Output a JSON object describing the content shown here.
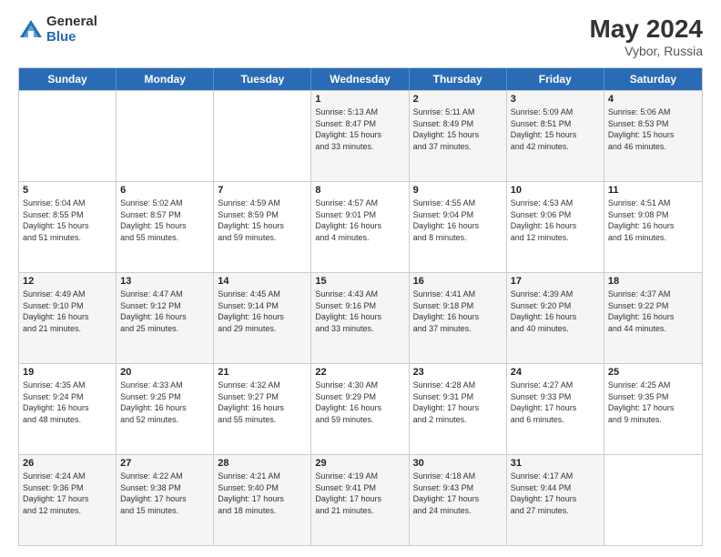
{
  "header": {
    "logo_general": "General",
    "logo_blue": "Blue",
    "month_year": "May 2024",
    "location": "Vybor, Russia"
  },
  "days_of_week": [
    "Sunday",
    "Monday",
    "Tuesday",
    "Wednesday",
    "Thursday",
    "Friday",
    "Saturday"
  ],
  "weeks": [
    [
      {
        "day": "",
        "info": ""
      },
      {
        "day": "",
        "info": ""
      },
      {
        "day": "",
        "info": ""
      },
      {
        "day": "1",
        "info": "Sunrise: 5:13 AM\nSunset: 8:47 PM\nDaylight: 15 hours\nand 33 minutes."
      },
      {
        "day": "2",
        "info": "Sunrise: 5:11 AM\nSunset: 8:49 PM\nDaylight: 15 hours\nand 37 minutes."
      },
      {
        "day": "3",
        "info": "Sunrise: 5:09 AM\nSunset: 8:51 PM\nDaylight: 15 hours\nand 42 minutes."
      },
      {
        "day": "4",
        "info": "Sunrise: 5:06 AM\nSunset: 8:53 PM\nDaylight: 15 hours\nand 46 minutes."
      }
    ],
    [
      {
        "day": "5",
        "info": "Sunrise: 5:04 AM\nSunset: 8:55 PM\nDaylight: 15 hours\nand 51 minutes."
      },
      {
        "day": "6",
        "info": "Sunrise: 5:02 AM\nSunset: 8:57 PM\nDaylight: 15 hours\nand 55 minutes."
      },
      {
        "day": "7",
        "info": "Sunrise: 4:59 AM\nSunset: 8:59 PM\nDaylight: 15 hours\nand 59 minutes."
      },
      {
        "day": "8",
        "info": "Sunrise: 4:57 AM\nSunset: 9:01 PM\nDaylight: 16 hours\nand 4 minutes."
      },
      {
        "day": "9",
        "info": "Sunrise: 4:55 AM\nSunset: 9:04 PM\nDaylight: 16 hours\nand 8 minutes."
      },
      {
        "day": "10",
        "info": "Sunrise: 4:53 AM\nSunset: 9:06 PM\nDaylight: 16 hours\nand 12 minutes."
      },
      {
        "day": "11",
        "info": "Sunrise: 4:51 AM\nSunset: 9:08 PM\nDaylight: 16 hours\nand 16 minutes."
      }
    ],
    [
      {
        "day": "12",
        "info": "Sunrise: 4:49 AM\nSunset: 9:10 PM\nDaylight: 16 hours\nand 21 minutes."
      },
      {
        "day": "13",
        "info": "Sunrise: 4:47 AM\nSunset: 9:12 PM\nDaylight: 16 hours\nand 25 minutes."
      },
      {
        "day": "14",
        "info": "Sunrise: 4:45 AM\nSunset: 9:14 PM\nDaylight: 16 hours\nand 29 minutes."
      },
      {
        "day": "15",
        "info": "Sunrise: 4:43 AM\nSunset: 9:16 PM\nDaylight: 16 hours\nand 33 minutes."
      },
      {
        "day": "16",
        "info": "Sunrise: 4:41 AM\nSunset: 9:18 PM\nDaylight: 16 hours\nand 37 minutes."
      },
      {
        "day": "17",
        "info": "Sunrise: 4:39 AM\nSunset: 9:20 PM\nDaylight: 16 hours\nand 40 minutes."
      },
      {
        "day": "18",
        "info": "Sunrise: 4:37 AM\nSunset: 9:22 PM\nDaylight: 16 hours\nand 44 minutes."
      }
    ],
    [
      {
        "day": "19",
        "info": "Sunrise: 4:35 AM\nSunset: 9:24 PM\nDaylight: 16 hours\nand 48 minutes."
      },
      {
        "day": "20",
        "info": "Sunrise: 4:33 AM\nSunset: 9:25 PM\nDaylight: 16 hours\nand 52 minutes."
      },
      {
        "day": "21",
        "info": "Sunrise: 4:32 AM\nSunset: 9:27 PM\nDaylight: 16 hours\nand 55 minutes."
      },
      {
        "day": "22",
        "info": "Sunrise: 4:30 AM\nSunset: 9:29 PM\nDaylight: 16 hours\nand 59 minutes."
      },
      {
        "day": "23",
        "info": "Sunrise: 4:28 AM\nSunset: 9:31 PM\nDaylight: 17 hours\nand 2 minutes."
      },
      {
        "day": "24",
        "info": "Sunrise: 4:27 AM\nSunset: 9:33 PM\nDaylight: 17 hours\nand 6 minutes."
      },
      {
        "day": "25",
        "info": "Sunrise: 4:25 AM\nSunset: 9:35 PM\nDaylight: 17 hours\nand 9 minutes."
      }
    ],
    [
      {
        "day": "26",
        "info": "Sunrise: 4:24 AM\nSunset: 9:36 PM\nDaylight: 17 hours\nand 12 minutes."
      },
      {
        "day": "27",
        "info": "Sunrise: 4:22 AM\nSunset: 9:38 PM\nDaylight: 17 hours\nand 15 minutes."
      },
      {
        "day": "28",
        "info": "Sunrise: 4:21 AM\nSunset: 9:40 PM\nDaylight: 17 hours\nand 18 minutes."
      },
      {
        "day": "29",
        "info": "Sunrise: 4:19 AM\nSunset: 9:41 PM\nDaylight: 17 hours\nand 21 minutes."
      },
      {
        "day": "30",
        "info": "Sunrise: 4:18 AM\nSunset: 9:43 PM\nDaylight: 17 hours\nand 24 minutes."
      },
      {
        "day": "31",
        "info": "Sunrise: 4:17 AM\nSunset: 9:44 PM\nDaylight: 17 hours\nand 27 minutes."
      },
      {
        "day": "",
        "info": ""
      }
    ]
  ]
}
